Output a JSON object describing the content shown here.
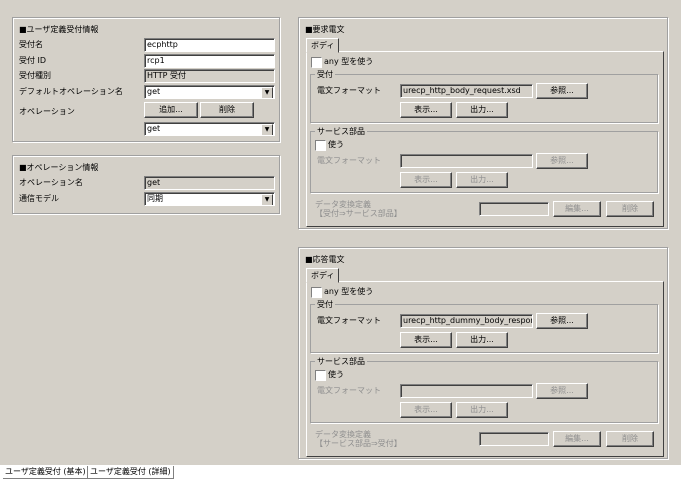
{
  "user_info": {
    "title": "■ユーザ定義受付情報",
    "name_label": "受付名",
    "name_value": "ecphttp",
    "id_label": "受付 ID",
    "id_value": "rcp1",
    "type_label": "受付種別",
    "type_value": "HTTP 受付",
    "default_op_label": "デフォルトオペレーション名",
    "default_op_value": "get",
    "op_label": "オペレーション",
    "add_button": "追加...",
    "delete_button": "削除",
    "op_select_value": "get"
  },
  "op_info": {
    "title": "■オペレーション情報",
    "op_name_label": "オペレーション名",
    "op_name_value": "get",
    "comm_model_label": "通信モデル",
    "comm_model_value": "同期"
  },
  "request": {
    "title": "■要求電文",
    "tab": "ボディ",
    "any_label": "any 型を使う",
    "any_checked": false,
    "recv_group": "受付",
    "format_label": "電文フォーマット",
    "format_value": "urecp_http_body_request.xsd",
    "browse": "参照...",
    "show": "表示...",
    "output": "出力...",
    "svc_group": "サービス部品",
    "use_label": "使う",
    "use_checked": false,
    "svc_format_label": "電文フォーマット",
    "svc_format_value": "",
    "svc_browse": "参照...",
    "svc_show": "表示...",
    "svc_output": "出力...",
    "conv_label1": "データ変換定義",
    "conv_label2": "【受付⇒サービス部品】",
    "conv_value": "",
    "edit": "編集...",
    "delete": "削除"
  },
  "response": {
    "title": "■応答電文",
    "tab": "ボディ",
    "any_label": "any 型を使う",
    "any_checked": false,
    "recv_group": "受付",
    "format_label": "電文フォーマット",
    "format_value": "urecp_http_dummy_body_response.xsd",
    "browse": "参照...",
    "show": "表示...",
    "output": "出力...",
    "svc_group": "サービス部品",
    "use_label": "使う",
    "use_checked": false,
    "svc_format_label": "電文フォーマット",
    "svc_format_value": "",
    "svc_browse": "参照...",
    "svc_show": "表示...",
    "svc_output": "出力...",
    "conv_label1": "データ変換定義",
    "conv_label2": "【サービス部品⇒受付】",
    "conv_value": "",
    "edit": "編集...",
    "delete": "削除"
  },
  "bottom_tabs": [
    "ユーザ定義受付 (基本)",
    "ユーザ定義受付 (詳細)"
  ]
}
